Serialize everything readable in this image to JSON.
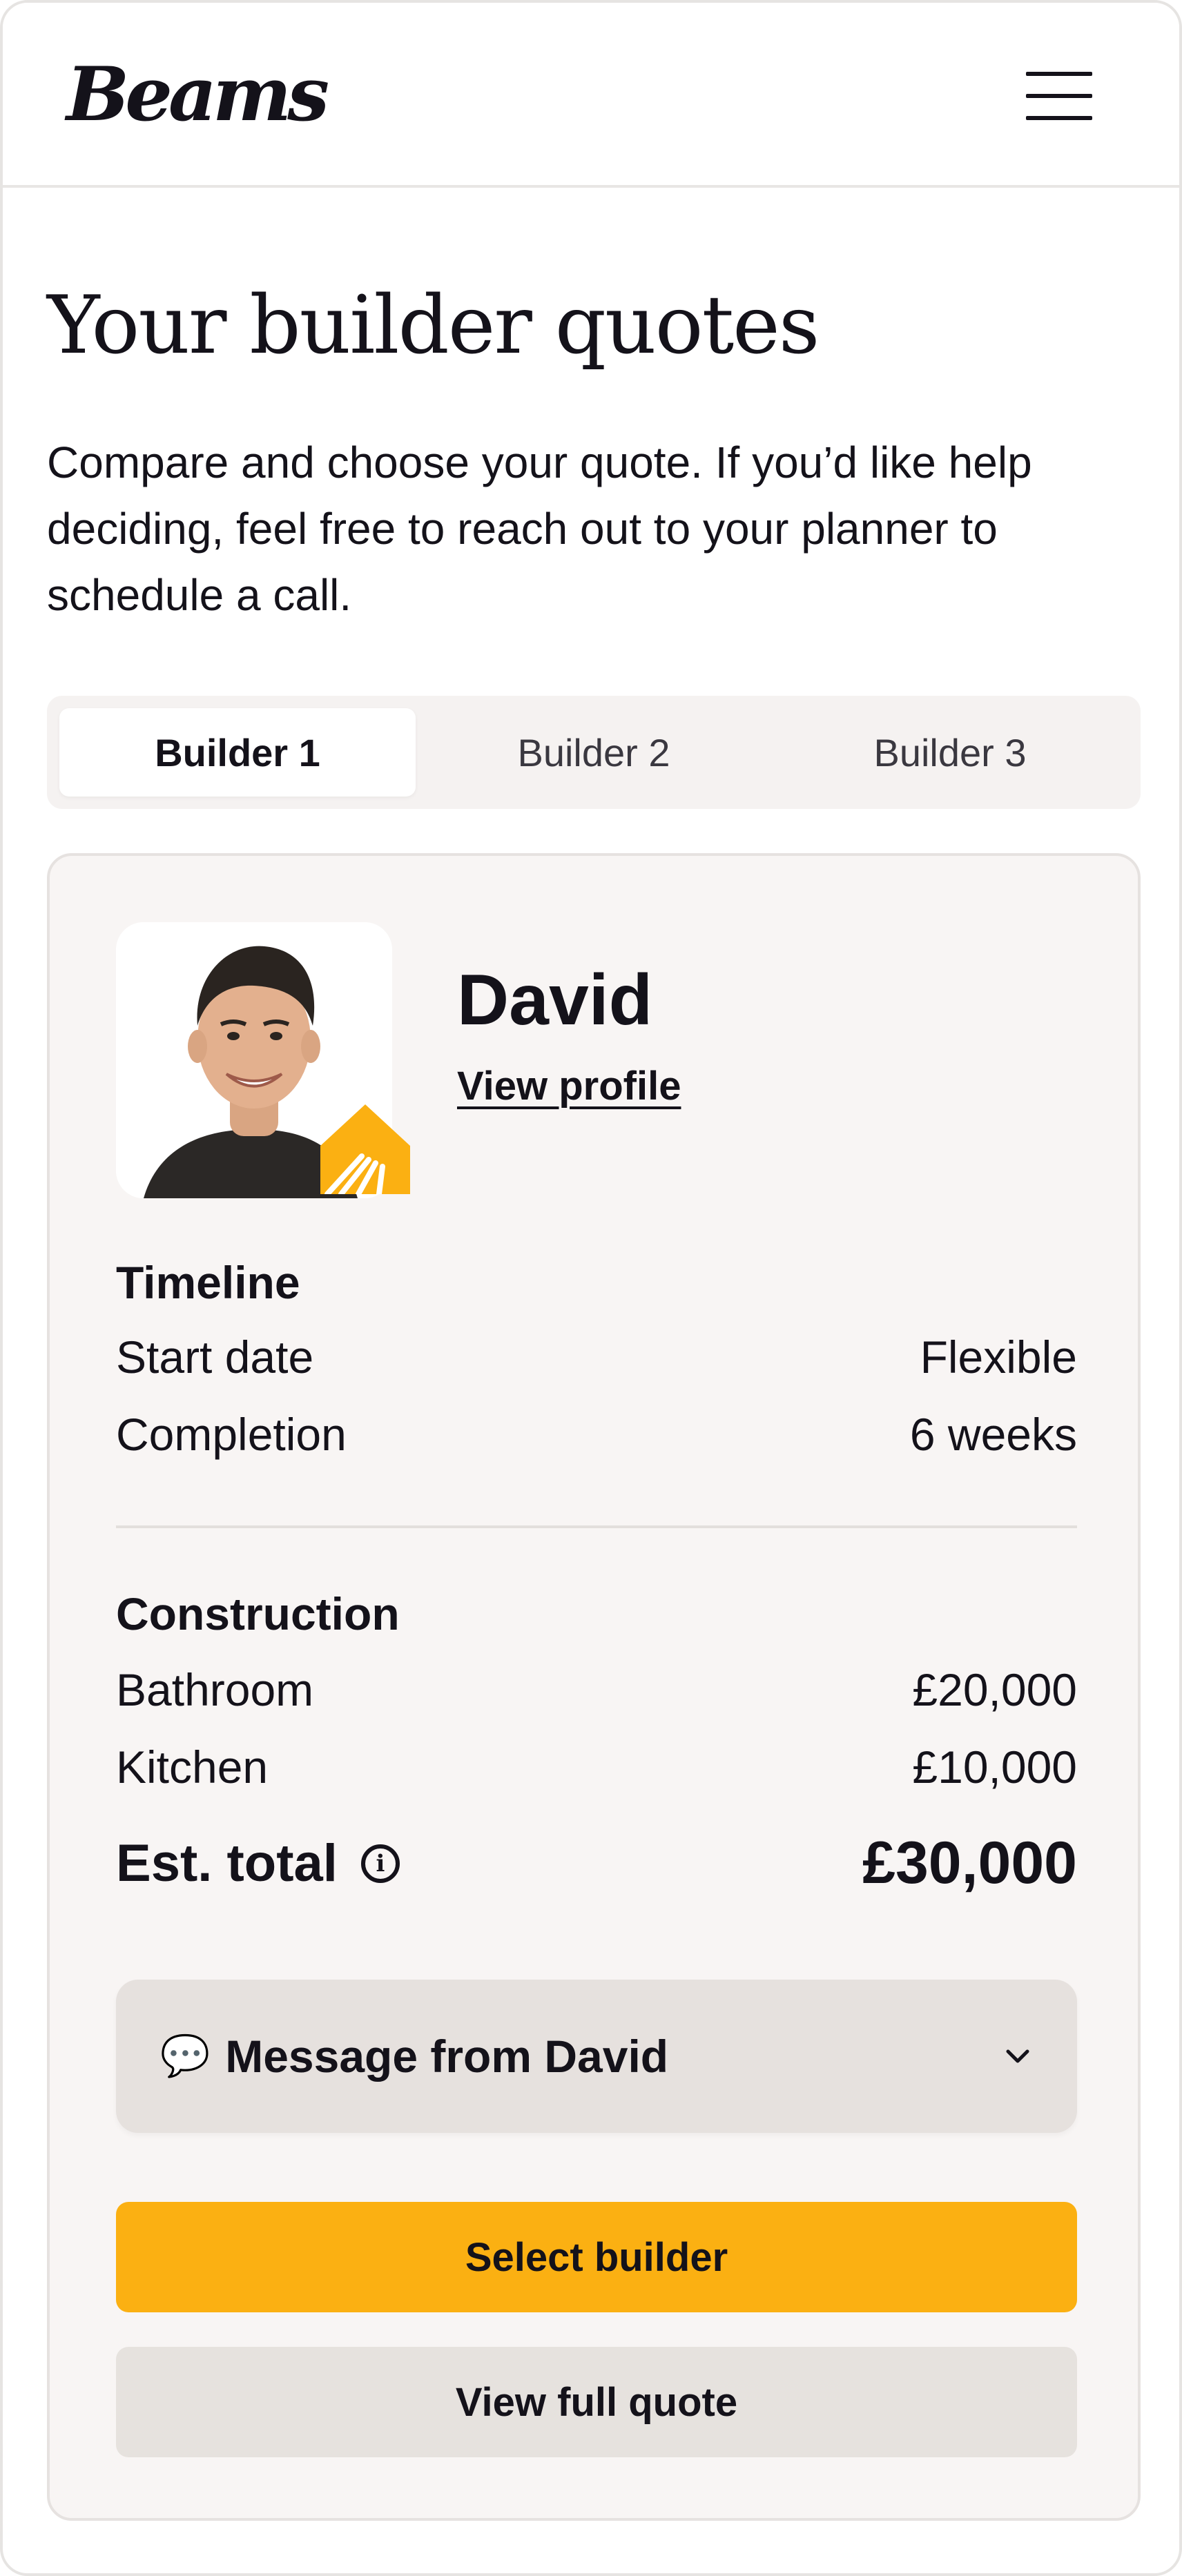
{
  "brand": {
    "logo": "Beams",
    "accent": "#fbb012"
  },
  "header": {
    "menu_icon": "hamburger-menu-icon"
  },
  "page": {
    "title": "Your builder quotes",
    "intro_line1": "Compare and choose your quote. If you’d like help",
    "intro_line2": "deciding, feel free to reach out to your planner to",
    "intro_line3": "schedule a call."
  },
  "tabs": [
    {
      "label": "Builder 1",
      "active": true
    },
    {
      "label": "Builder 2",
      "active": false
    },
    {
      "label": "Builder 3",
      "active": false
    }
  ],
  "builder": {
    "name": "David",
    "view_profile": "View profile"
  },
  "timeline": {
    "title": "Timeline",
    "rows": [
      {
        "label": "Start date",
        "value": "Flexible"
      },
      {
        "label": "Completion",
        "value": "6 weeks"
      }
    ]
  },
  "construction": {
    "title": "Construction",
    "rows": [
      {
        "label": "Bathroom",
        "value": "£20,000"
      },
      {
        "label": "Kitchen",
        "value": "£10,000"
      }
    ],
    "total_label": "Est. total",
    "total_value": "£30,000"
  },
  "message": {
    "emoji": "💬",
    "label": "Message from David"
  },
  "actions": {
    "select_label": "Select builder",
    "view_quote_label": "View full quote"
  }
}
